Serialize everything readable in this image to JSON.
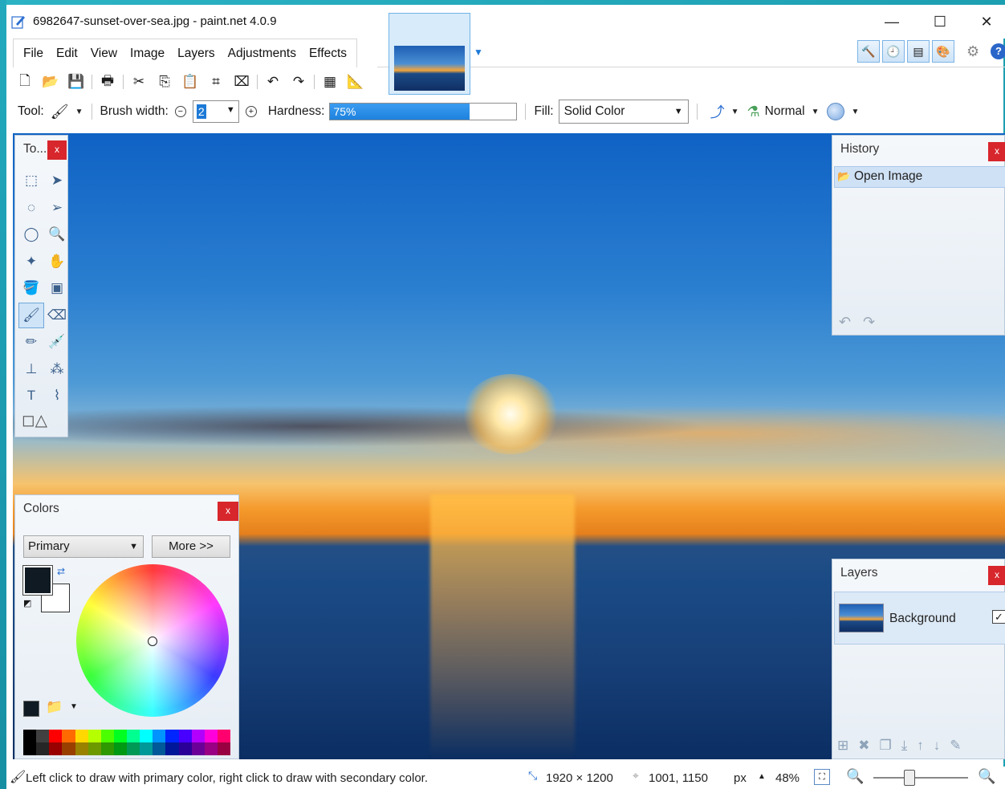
{
  "window": {
    "title": "6982647-sunset-over-sea.jpg - paint.net 4.0.9",
    "minimize": "—",
    "maximize": "☐",
    "close": "✕"
  },
  "menu": [
    "File",
    "Edit",
    "View",
    "Image",
    "Layers",
    "Adjustments",
    "Effects"
  ],
  "toolbar": {
    "tool_label": "Tool:",
    "brush_width_label": "Brush width:",
    "brush_width_value": "2",
    "hardness_label": "Hardness:",
    "hardness_value": "75%",
    "hardness_fraction": 0.75,
    "fill_label": "Fill:",
    "fill_value": "Solid Color",
    "blend_mode": "Normal"
  },
  "tools_panel": {
    "title": "To...",
    "close": "x"
  },
  "history_panel": {
    "title": "History",
    "close": "x",
    "items": [
      "Open Image"
    ]
  },
  "colors_panel": {
    "title": "Colors",
    "close": "x",
    "selected": "Primary",
    "more_button": "More >>",
    "primary_color": "#0f1a22",
    "secondary_color": "#ffffff",
    "palette": [
      "#000000",
      "#404040",
      "#ff0000",
      "#ff6a00",
      "#ffd800",
      "#b6ff00",
      "#4cff00",
      "#00ff21",
      "#00ff90",
      "#00ffff",
      "#0094ff",
      "#0026ff",
      "#4800ff",
      "#b200ff",
      "#ff00dc",
      "#ff006e"
    ]
  },
  "layers_panel": {
    "title": "Layers",
    "close": "x",
    "layers": [
      {
        "name": "Background",
        "visible": true
      }
    ]
  },
  "status": {
    "message": "Left click to draw with primary color, right click to draw with secondary color.",
    "image_size": "1920 × 1200",
    "cursor_position": "1001, 1150",
    "units": "px",
    "zoom": "48%"
  }
}
